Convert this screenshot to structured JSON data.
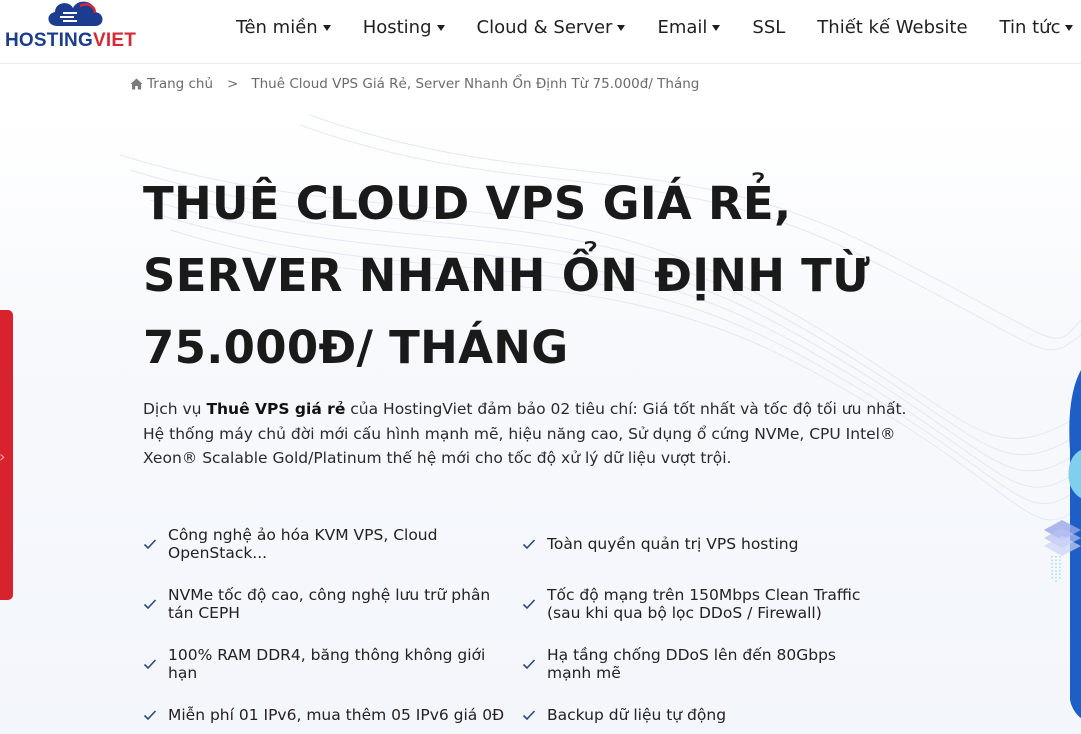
{
  "logo": {
    "part1": "HOSTING",
    "part2": "VIET"
  },
  "nav": {
    "items": [
      {
        "label": "Tên miền",
        "dropdown": true
      },
      {
        "label": "Hosting",
        "dropdown": true
      },
      {
        "label": "Cloud & Server",
        "dropdown": true
      },
      {
        "label": "Email",
        "dropdown": true
      },
      {
        "label": "SSL",
        "dropdown": false
      },
      {
        "label": "Thiết kế Website",
        "dropdown": false
      },
      {
        "label": "Tin tức",
        "dropdown": true
      }
    ]
  },
  "breadcrumb": {
    "home": "Trang chủ",
    "separator": ">",
    "current": "Thuê Cloud VPS Giá Rẻ, Server Nhanh Ổn Định Từ 75.000đ/ Tháng"
  },
  "hero": {
    "title_lines": [
      "THUÊ CLOUD VPS GIÁ RẺ,",
      "SERVER NHANH ỔN ĐỊNH TỪ",
      "75.000Đ/ THÁNG"
    ],
    "desc_prefix": "Dịch vụ ",
    "desc_bold": "Thuê VPS giá rẻ",
    "desc_rest": " của HostingViet đảm bảo 02 tiêu chí: Giá tốt nhất và tốc độ tối ưu nhất. Hệ thống máy chủ đời mới cấu hình mạnh mẽ, hiệu năng cao, Sử dụng ổ cứng NVMe, CPU Intel® Xeon® Scalable Gold/Platinum thế hệ mới cho tốc độ xử lý dữ liệu vượt trội."
  },
  "features": [
    {
      "lines": [
        "Công nghệ ảo hóa KVM VPS, Cloud",
        "OpenStack..."
      ]
    },
    {
      "lines": [
        "Toàn quyền quản trị VPS hosting"
      ]
    },
    {
      "lines": [
        "NVMe tốc độ cao, công nghệ lưu trữ phân",
        "tán CEPH"
      ]
    },
    {
      "lines": [
        "Tốc độ mạng trên 150Mbps Clean Traffic",
        "(sau khi qua bộ lọc DDoS / Firewall)"
      ]
    },
    {
      "lines": [
        "100% RAM DDR4, băng thông không giới",
        "hạn"
      ]
    },
    {
      "lines": [
        "Hạ tầng chống DDoS lên đến 80Gbps",
        "mạnh mẽ"
      ]
    },
    {
      "lines": [
        "Miễn phí 01 IPv6, mua thêm 05 IPv6 giá 0Đ"
      ]
    },
    {
      "lines": [
        "Backup dữ liệu tự động"
      ]
    }
  ],
  "colors": {
    "brand_blue": "#1b3c8f",
    "brand_red": "#d42a34",
    "check": "#2b4a7e",
    "side_tab": "#d8232f"
  }
}
